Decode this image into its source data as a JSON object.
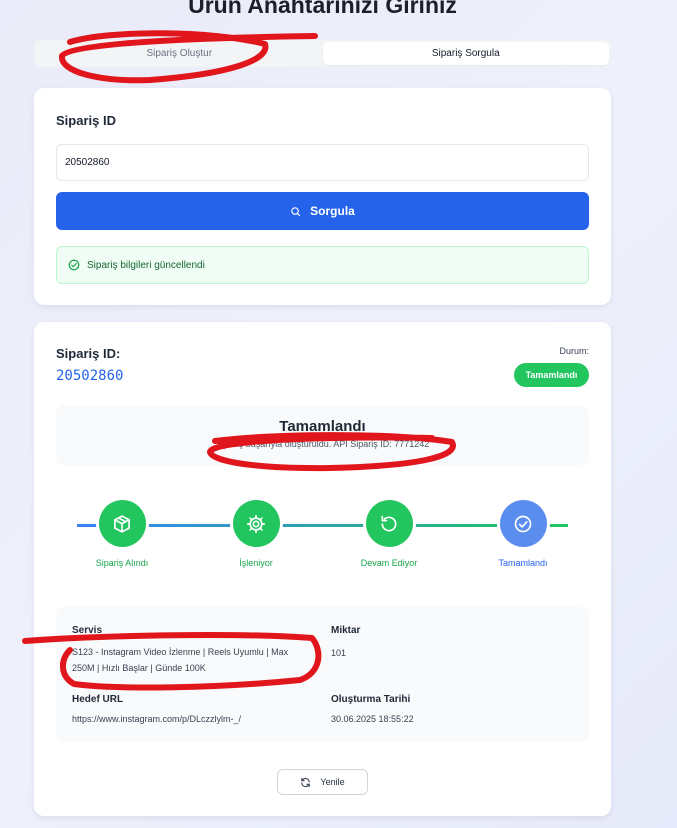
{
  "page": {
    "title": "Ürün Anahtarınızı Giriniz"
  },
  "tabs": [
    {
      "label": "Sipariş Oluştur",
      "active": false
    },
    {
      "label": "Sipariş Sorgula",
      "active": true
    }
  ],
  "query_form": {
    "label": "Sipariş ID",
    "input_value": "20502860",
    "button_label": "Sorgula",
    "alert_text": "Sipariş bilgileri güncellendi"
  },
  "order": {
    "id_label": "Sipariş ID:",
    "id_value": "20502860",
    "status_label": "Durum:",
    "status_badge": "Tamamlandı",
    "summary_title": "Tamamlandı",
    "summary_message": "Sipariş başarıyla oluşturuldu. API Sipariş ID: 7771242",
    "steps": [
      {
        "label": "Sipariş Alındı",
        "icon": "package-icon",
        "done": true
      },
      {
        "label": "İşleniyor",
        "icon": "gear-icon",
        "done": true
      },
      {
        "label": "Devam Ediyor",
        "icon": "rotate-ccw-icon",
        "done": true
      },
      {
        "label": "Tamamlandı",
        "icon": "check-circle-icon",
        "done": true
      }
    ],
    "details": {
      "service_label": "Servis",
      "service_value": "S123 - Instagram Video İzlenme | Reels Uyumlu | Max 250M | Hızlı Başlar | Günde 100K",
      "quantity_label": "Miktar",
      "quantity_value": "101",
      "target_label": "Hedef URL",
      "target_value": "https://www.instagram.com/p/DLczzlylm-_/",
      "created_label": "Oluşturma Tarihi",
      "created_value": "30.06.2025 18:55:22"
    },
    "refresh_label": "Yenile"
  },
  "colors": {
    "primary": "#2563eb",
    "success": "#22c55e",
    "marker": "#e0161c"
  }
}
